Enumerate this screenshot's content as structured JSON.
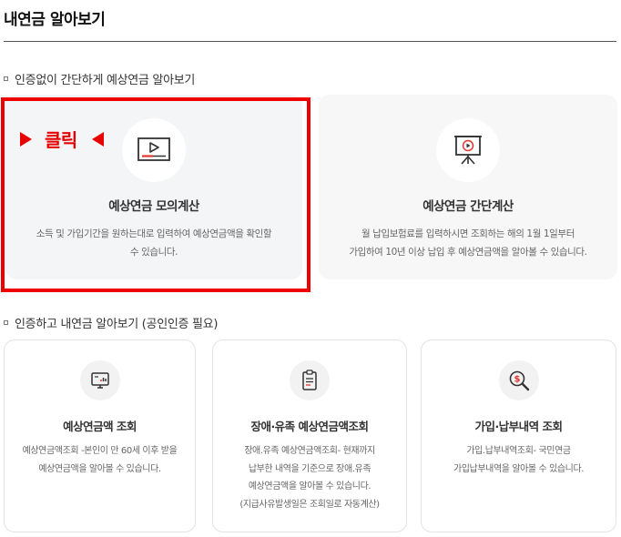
{
  "page": {
    "title": "내연금 알아보기"
  },
  "section_no_auth": {
    "heading": "인증없이 간단하게 예상연금 알아보기",
    "cards": [
      {
        "title": "예상연금 모의계산",
        "description": "소득 및 가입기간을 원하는대로 입력하여 예상연금액을 확인할\n수 있습니다.",
        "icon": "video-play-icon"
      },
      {
        "title": "예상연금 간단계산",
        "description": "월 납입보험료를 입력하시면 조회하는 해의 1월 1일부터\n가입하여 10년 이상 납입 후 예상연금액을 알아볼 수 있습니다.",
        "icon": "presentation-board-icon"
      }
    ]
  },
  "annotation": {
    "click_text": "클릭",
    "color": "#e60000"
  },
  "section_auth": {
    "heading": "인증하고 내연금 알아보기 (공인인증 필요)",
    "cards": [
      {
        "title": "예상연금액 조회",
        "description": "예상연금액조회 -본인이 만 60세 이후 받을\n예상연금액을 알아볼 수 있습니다.",
        "icon": "monitor-chart-icon"
      },
      {
        "title": "장애·유족 예상연금액조회",
        "description": "장애.유족 예상연금액조회- 현재까지\n납부한 내역을 기준으로 장애.유족\n예상연금액을 알아볼 수 있습니다.\n(지급사유발생일은 조회일로 자동계산)",
        "icon": "clipboard-icon"
      },
      {
        "title": "가입·납부내역 조회",
        "description": "가입.납부내역조회- 국민연금\n가입납부내역을 알아볼 수 있습니다.",
        "icon": "money-search-icon"
      }
    ]
  }
}
